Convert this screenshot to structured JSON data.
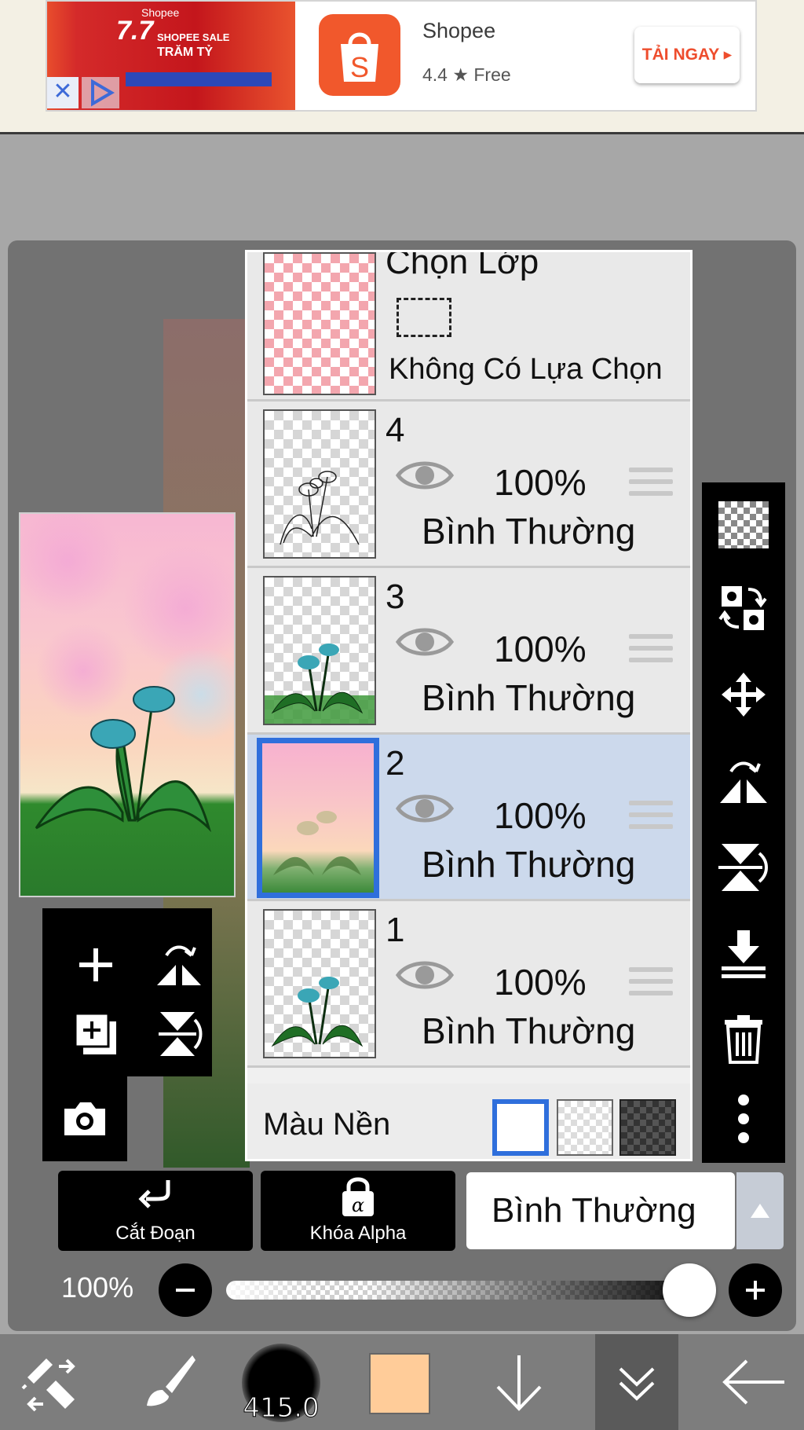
{
  "ad": {
    "banner_brand": "Shopee",
    "banner_big": "7.7",
    "banner_line1": "SHOPEE SALE",
    "banner_line2": "TRĂM TỶ",
    "close_glyph": "✕",
    "app_name": "Shopee",
    "rating": "4.4 ★  Free",
    "cta": "TẢI NGAY ▸",
    "brand_color": "#ee4d2d"
  },
  "layer_panel": {
    "selection_row": {
      "title": "Chọn Lớp",
      "status": "Không Có Lựa Chọn"
    },
    "layers": [
      {
        "number": "4",
        "opacity": "100%",
        "blend": "Bình Thường",
        "selected": false,
        "thumb": "sketch"
      },
      {
        "number": "3",
        "opacity": "100%",
        "blend": "Bình Thường",
        "selected": false,
        "thumb": "flower-grass"
      },
      {
        "number": "2",
        "opacity": "100%",
        "blend": "Bình Thường",
        "selected": true,
        "thumb": "sky-flower"
      },
      {
        "number": "1",
        "opacity": "100%",
        "blend": "Bình Thường",
        "selected": false,
        "thumb": "flower"
      }
    ],
    "background": {
      "label": "Màu Nền",
      "options": [
        "white",
        "transparent",
        "dark-checker"
      ],
      "selected": "white"
    }
  },
  "right_toolbar": {
    "icons": [
      "checker-icon",
      "layer-swap-icon",
      "move-icon",
      "flip-horizontal-icon",
      "flip-vertical-icon",
      "merge-down-icon",
      "trash-icon",
      "more-icon"
    ]
  },
  "left_tools": {
    "icons": [
      "add-layer-icon",
      "flip-h-small-icon",
      "duplicate-layer-icon",
      "flip-v-small-icon",
      "camera-icon"
    ]
  },
  "bottom_controls": {
    "clipping_label": "Cắt Đoạn",
    "alpha_lock_label": "Khóa Alpha",
    "blend_mode": "Bình Thường",
    "opacity_label": "100%",
    "opacity_value": 1.0
  },
  "bottom_toolbar": {
    "brush_size": "415.0",
    "current_color": "#ffcc99",
    "tools": [
      "select-tool-icon",
      "brush-tool-icon",
      "brush-size",
      "color-swatch",
      "down-arrow-icon",
      "layers-icon",
      "back-icon"
    ]
  },
  "colors": {
    "accent": "#2f6fdc",
    "selected_row": "#ccd9ec",
    "toolbar": "#000000"
  }
}
